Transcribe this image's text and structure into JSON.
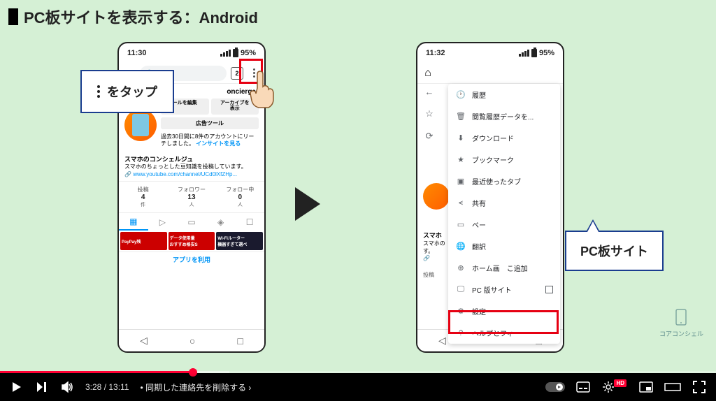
{
  "title": "PC板サイトを表示する：Android",
  "phone_left": {
    "time": "11:30",
    "battery": "95%",
    "tab_count": "2",
    "username": "oncierge",
    "btn_edit": "ールを編集",
    "btn_archive_l1": "アーカイブを",
    "btn_archive_l2": "表示",
    "btn_ad": "広告ツール",
    "insight_l1": "過去30日間に8件のアカウントにリーチしました。",
    "insight_l2": "インサイトを見る",
    "bio_title": "スマホのコンシェルジュ",
    "bio_text": "スマホのちょっとした豆知識を投稿しています。",
    "bio_link": "www.youtube.com/channel/UCd0lXfZHp...",
    "stats": [
      {
        "label": "投稿",
        "num": "4",
        "unit": "件"
      },
      {
        "label": "フォロワー",
        "num": "13",
        "unit": "人"
      },
      {
        "label": "フォロー中",
        "num": "0",
        "unit": "人"
      }
    ],
    "ad1": "PayPay残",
    "ad2_l1": "データ使用量",
    "ad2_l2": "おすすめ格安S",
    "ad3_l1": "Wi-Fiルーター",
    "ad3_l2": "機器すぎて選べ",
    "app_btn": "アプリを利用"
  },
  "phone_right": {
    "time": "11:32",
    "battery": "95%",
    "bio_title": "スマホ",
    "bio_text": "スマホの",
    "bio_text2": "す。",
    "stat_label": "投稿",
    "menu": {
      "history": "履歴",
      "clear_data": "閲覧履歴データを...",
      "downloads": "ダウンロード",
      "bookmarks": "ブックマーク",
      "recent_tabs": "最近使ったタブ",
      "share": "共有",
      "page": "ペー",
      "translate": "翻訳",
      "add_home": "ホーム画　こ追加",
      "pc_site": "PC 版サイト",
      "settings": "設定",
      "help": "ヘルプとフィ"
    }
  },
  "callout1": "をタップ",
  "callout2": "PC板サイト",
  "watermark": "コアコンシェル",
  "video": {
    "current": "3:28",
    "total": "13:11",
    "chapter": "同期した連絡先を削除する",
    "hd": "HD"
  }
}
